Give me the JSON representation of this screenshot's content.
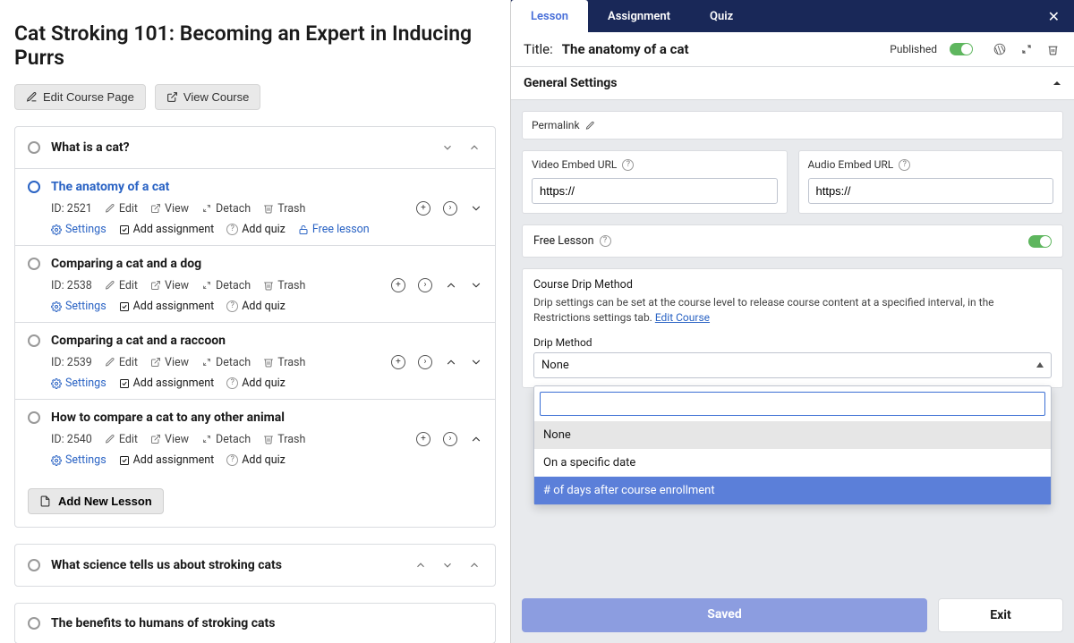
{
  "course": {
    "title": "Cat Stroking 101: Becoming an Expert in Inducing Purrs",
    "edit_label": "Edit Course Page",
    "view_label": "View Course"
  },
  "sections": [
    {
      "title": "What is a cat?",
      "lessons": [
        {
          "title": "The anatomy of a cat",
          "active": true,
          "id_label": "ID: 2521",
          "free_lesson": true,
          "show_up": false
        },
        {
          "title": "Comparing a cat and a dog",
          "active": false,
          "id_label": "ID: 2538",
          "free_lesson": false,
          "show_up": true
        },
        {
          "title": "Comparing a cat and a raccoon",
          "active": false,
          "id_label": "ID: 2539",
          "free_lesson": false,
          "show_up": true
        },
        {
          "title": "How to compare a cat to any other animal",
          "active": false,
          "id_label": "ID: 2540",
          "free_lesson": false,
          "show_up": true,
          "hide_down": true
        }
      ],
      "add_new": "Add New Lesson"
    },
    {
      "title": "What science tells us about stroking cats",
      "collapsed": true
    },
    {
      "title": "The benefits to humans of stroking cats",
      "collapsed": true
    }
  ],
  "lesson_action_labels": {
    "edit": "Edit",
    "view": "View",
    "detach": "Detach",
    "trash": "Trash",
    "settings": "Settings",
    "add_assignment": "Add assignment",
    "add_quiz": "Add quiz",
    "free_lesson": "Free lesson"
  },
  "panel": {
    "tabs": {
      "lesson": "Lesson",
      "assignment": "Assignment",
      "quiz": "Quiz"
    },
    "title_label": "Title:",
    "title_value": "The anatomy of a cat",
    "published_label": "Published",
    "section_title": "General Settings",
    "permalink_label": "Permalink",
    "video_label": "Video Embed URL",
    "video_value": "https://",
    "audio_label": "Audio Embed URL",
    "audio_value": "https://",
    "free_lesson_label": "Free Lesson",
    "drip_title": "Course Drip Method",
    "drip_desc_pre": "Drip settings can be set at the course level to release course content at a specified interval, in the Restrictions settings tab. ",
    "drip_link": "Edit Course",
    "drip_method_label": "Drip Method",
    "drip_selected": "None",
    "drip_options": [
      "None",
      "On a specific date",
      "# of days after course enrollment"
    ],
    "saved": "Saved",
    "exit": "Exit"
  }
}
